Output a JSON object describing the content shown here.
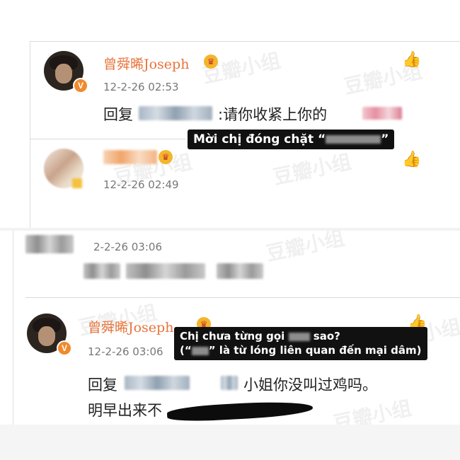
{
  "watermark": "豆瓣小组",
  "comments": [
    {
      "username": "曾舜晞Joseph",
      "verified_badge": "V",
      "crown_icon": "crown-icon",
      "time": "12-2-26 02:53",
      "reply_prefix": "回复",
      "reply_text": ":请你收紧上你的",
      "like_icon": "thumbs-up-icon"
    },
    {
      "username": "",
      "crown_icon": "crown-icon",
      "time": "12-2-26 02:49",
      "like_icon": "thumbs-up-icon"
    },
    {
      "username": "",
      "time": "2-2-26 03:06"
    },
    {
      "username": "曾舜晞Joseph",
      "verified_badge": "V",
      "crown_icon": "crown-icon",
      "time": "12-2-26 03:06",
      "reply_prefix": "回复",
      "reply_text": "小姐你没叫过鸡吗。",
      "reply_text_line2": "明早出来不",
      "like_icon": "thumbs-up-icon"
    }
  ],
  "captions": {
    "caption1_text": "Mời chị đóng chặt “",
    "caption1_end": "”",
    "caption2_line1_a": "Chị chưa từng gọi ",
    "caption2_line1_b": " sao?",
    "caption2_line2_a": "(“",
    "caption2_line2_b": "” là từ lóng liên quan đến mại dâm)"
  },
  "colors": {
    "username": "#e8733a",
    "verified_badge": "#f08a2c",
    "caption_bg": "#111111"
  }
}
